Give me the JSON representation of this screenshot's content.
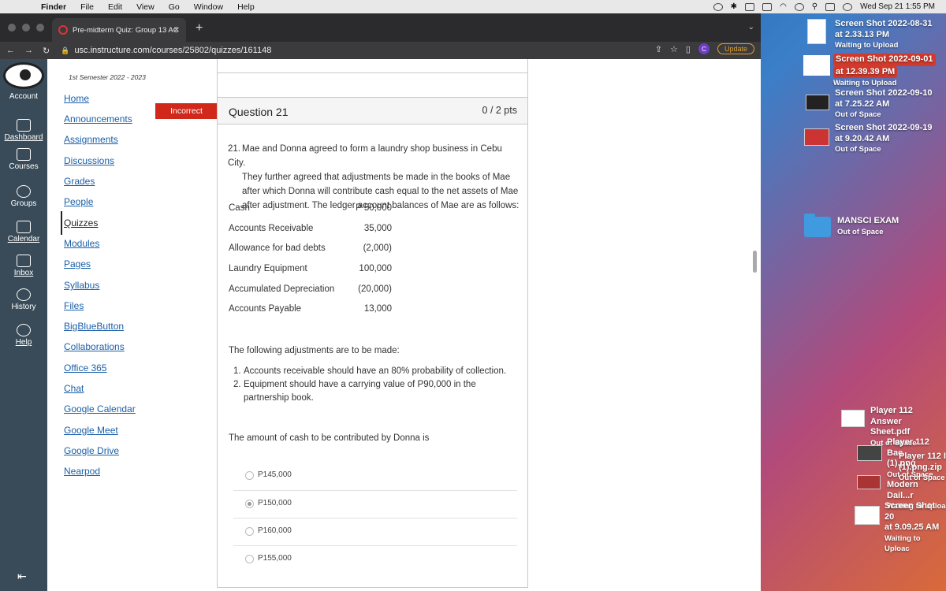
{
  "menubar": {
    "app_name": "Finder",
    "items": [
      "File",
      "Edit",
      "View",
      "Go",
      "Window",
      "Help"
    ],
    "datetime": "Wed Sep 21  1:55 PM"
  },
  "browser": {
    "tab_title": "Pre-midterm Quiz: Group 13 AC",
    "url": "usc.instructure.com/courses/25802/quizzes/161148",
    "profile_letter": "C",
    "update_label": "Update"
  },
  "global_nav": {
    "items": [
      {
        "label": "Account",
        "icon": "account-icon"
      },
      {
        "label": "Dashboard",
        "icon": "dashboard-icon"
      },
      {
        "label": "Courses",
        "icon": "courses-icon"
      },
      {
        "label": "Groups",
        "icon": "groups-icon"
      },
      {
        "label": "Calendar",
        "icon": "calendar-icon"
      },
      {
        "label": "Inbox",
        "icon": "inbox-icon"
      },
      {
        "label": "History",
        "icon": "history-icon"
      },
      {
        "label": "Help",
        "icon": "help-icon"
      }
    ]
  },
  "course_nav": {
    "term": "1st Semester 2022 - 2023",
    "links": [
      "Home",
      "Announcements",
      "Assignments",
      "Discussions",
      "Grades",
      "People",
      "Quizzes",
      "Modules",
      "Pages",
      "Syllabus",
      "Files",
      "BigBlueButton",
      "Collaborations",
      "Office 365",
      "Chat",
      "Google Calendar",
      "Google Meet",
      "Google Drive",
      "Nearpod"
    ],
    "active": "Quizzes"
  },
  "question": {
    "status": "Incorrect",
    "title": "Question 21",
    "points": "0 / 2 pts",
    "number": "21.",
    "text_lines": [
      "Mae and Donna agreed to form a laundry shop business in Cebu City.",
      "They further agreed that adjustments be made in the books of Mae",
      "after which Donna will contribute cash equal to the net assets of Mae",
      "after adjustment.  The ledger account balances of Mae are as follows:"
    ],
    "ledger": [
      {
        "account": "Cash",
        "amount": "P  50,000"
      },
      {
        "account": "Accounts Receivable",
        "amount": "35,000"
      },
      {
        "account": "Allowance for bad debts",
        "amount": "(2,000)"
      },
      {
        "account": "Laundry Equipment",
        "amount": "100,000"
      },
      {
        "account": "Accumulated Depreciation",
        "amount": "(20,000)"
      },
      {
        "account": "Accounts Payable",
        "amount": "13,000"
      }
    ],
    "adjustments_heading": "The following adjustments are to be made:",
    "adjustments": [
      {
        "n": "1.",
        "text": "Accounts receivable should have an 80% probability of collection."
      },
      {
        "n": "2.",
        "text": "Equipment should have a carrying value of P90,000 in the partnership book."
      }
    ],
    "prompt": "The amount of cash to be contributed by Donna is",
    "answers": [
      {
        "text": "P145,000",
        "selected": false
      },
      {
        "text": "P150,000",
        "selected": true
      },
      {
        "text": "P160,000",
        "selected": false
      },
      {
        "text": "P155,000",
        "selected": false
      }
    ]
  },
  "desktop": {
    "files": [
      {
        "name1": "Screen Shot 2022-08-31",
        "name2": "at 2.33.13 PM",
        "status": "Waiting to Upload"
      },
      {
        "name1": "Screen Shot 2022-09-01",
        "name2": "at 12.39.39 PM",
        "status": "Waiting to Upload"
      },
      {
        "name1": "Screen Shot 2022-09-10",
        "name2": "at 7.25.22 AM",
        "status": "Out of Space"
      },
      {
        "name1": "Screen Shot 2022-09-19",
        "name2": "at 9.20.42 AM",
        "status": "Out of Space"
      }
    ],
    "folder": {
      "name": "MANSCI EXAM",
      "status": "Out of Space"
    },
    "lower": [
      {
        "name1": "Player 112 Answer",
        "name2": "Sheet.pdf",
        "status": "Out of Space"
      },
      {
        "name1": "Player 112 Bac",
        "name2": "(1).png",
        "status": "Out of Space"
      },
      {
        "name1": "Player 112 I",
        "name2": "(1).png.zip",
        "status": "Out of Space"
      },
      {
        "name1": "Modern Dail...r",
        "name2": "",
        "status": "Waiting to Uploa"
      },
      {
        "name1": "Screen Shot 20",
        "name2": "at 9.09.25 AM",
        "status": "Waiting to Uploac"
      }
    ]
  }
}
